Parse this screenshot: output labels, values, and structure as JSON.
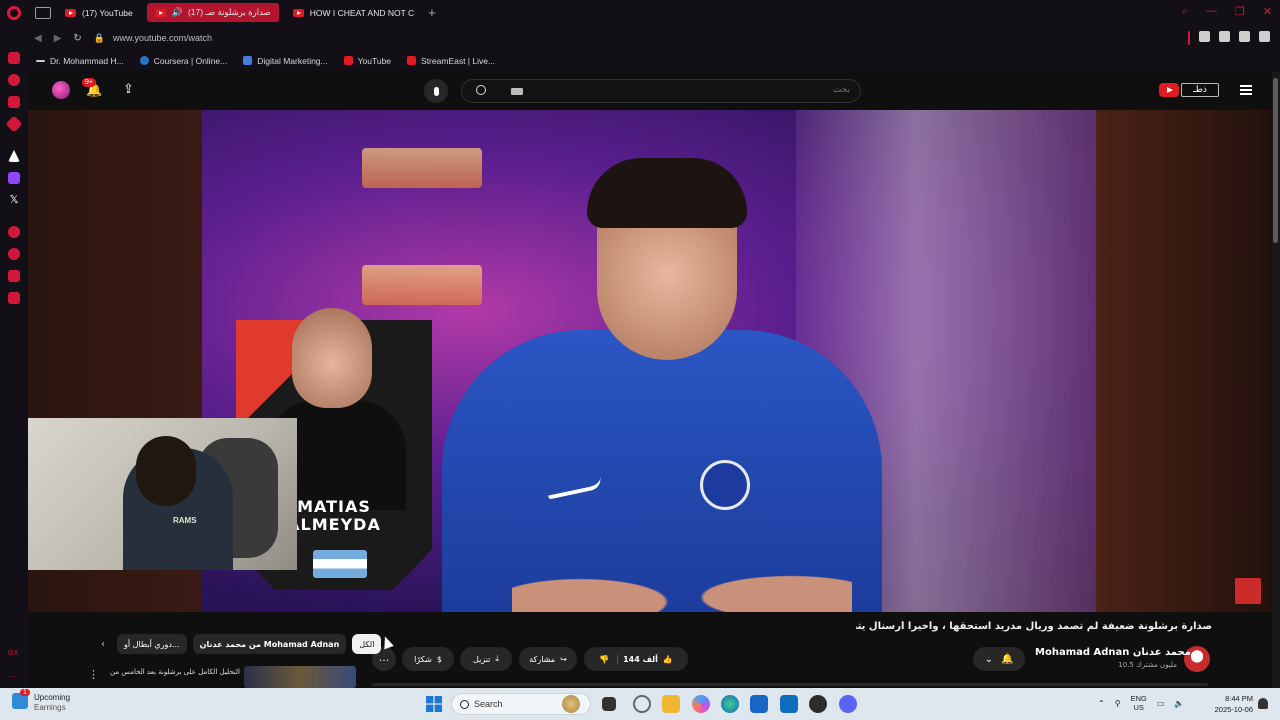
{
  "browser": {
    "tabs": [
      {
        "label": "(17) YouTube",
        "active": false
      },
      {
        "label": "(17) صدارة برشلونة ضـ",
        "active": true
      },
      {
        "label": "HOW I CHEAT AND NOT C",
        "active": false
      }
    ],
    "new_tab": "+",
    "url": "www.youtube.com/watch",
    "bookmarks": [
      {
        "label": "Dr. Mohammad H...",
        "icon_color": "#cccccc"
      },
      {
        "label": "Coursera | Online...",
        "icon_color": "#2a73cc"
      },
      {
        "label": "Digital Marketing...",
        "icon_color": "#4a7be0"
      },
      {
        "label": "YouTube",
        "icon_color": "#e01b22"
      },
      {
        "label": "StreamEast | Live...",
        "icon_color": "#e01b22"
      }
    ],
    "accent_color": "#d1183a"
  },
  "youtube": {
    "notification_count": "9+",
    "search_placeholder": "بحث",
    "brand_badge": "ذطـ"
  },
  "video": {
    "overlay_name_line1": "MATIAS",
    "overlay_name_line2": "ALMEYDA",
    "webcam_shirt_text": "RAMS"
  },
  "details": {
    "title": "صدارة برشلونة ضعيفة لم تصمد وريال مدريد استحقها ، وأخيراً أرسنال يتصدر 🔥",
    "channel_name": "Mohamad Adnan محمد عدنان",
    "subscribers": "10.5 مليون مشترك",
    "like_count": "144 ألف",
    "share_label": "مشاركة",
    "download_label": "تنزيل",
    "thanks_label": "شكرًا",
    "more_label": "…"
  },
  "chips": {
    "all_label": "الكل",
    "channel_chip": "من محمد عدنان Mohamad Adnan",
    "league_chip": "دوري أبطال أو..."
  },
  "recommendation": {
    "title": "التحليل الكامل على برشلونة بعد الخامس من مع السوسيداد ..."
  },
  "taskbar": {
    "weather_title": "Upcoming",
    "weather_sub": "Earnings",
    "weather_badge": "1",
    "search_label": "Search",
    "lang_top": "ENG",
    "lang_bottom": "US",
    "time": "8:44 PM",
    "date": "2025-10-06"
  }
}
